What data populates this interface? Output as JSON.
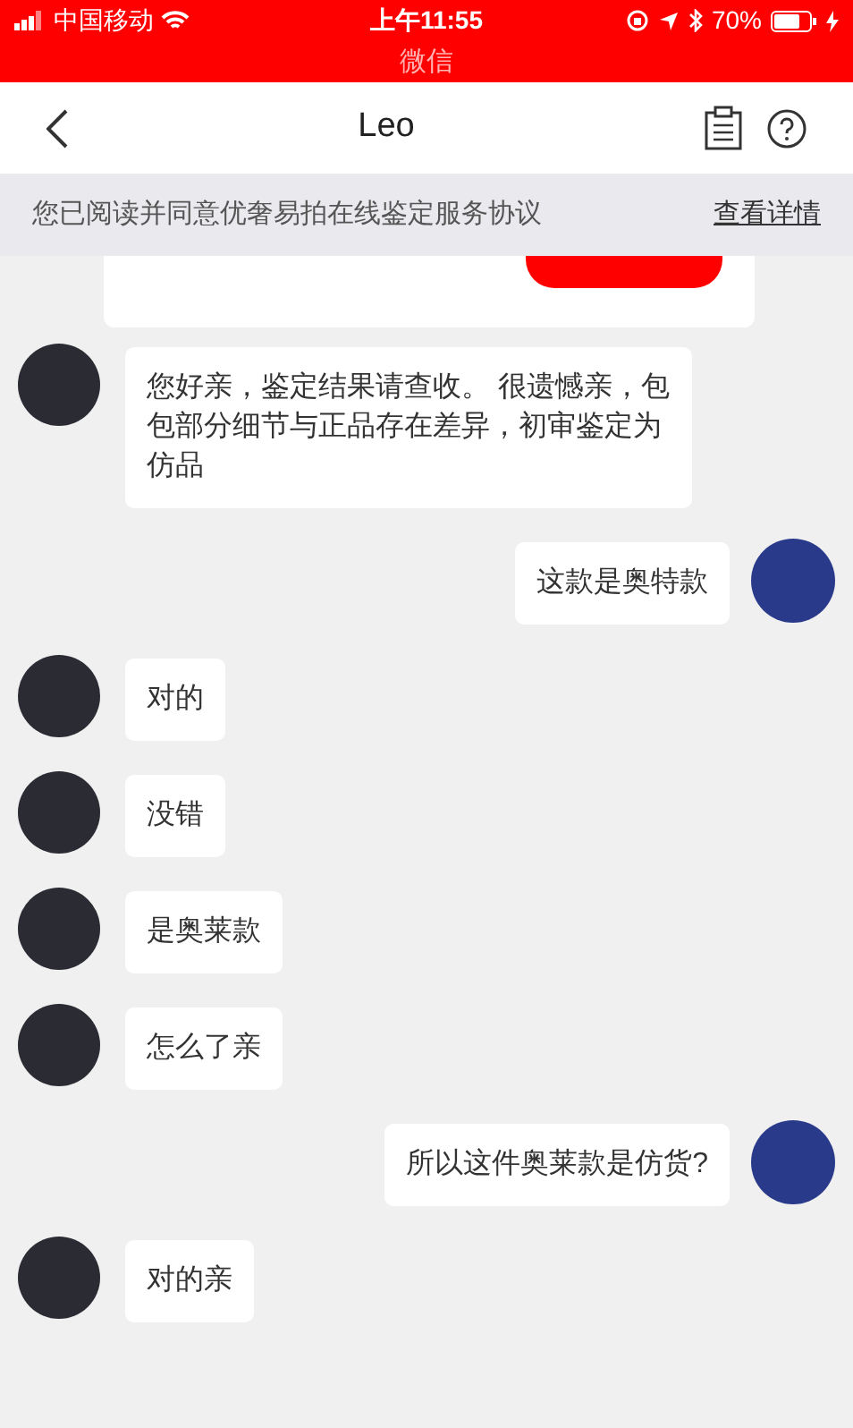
{
  "status_bar": {
    "carrier": "中国移动",
    "time": "上午11:55",
    "battery": "70%",
    "back_app": "微信"
  },
  "header": {
    "title": "Leo"
  },
  "notice": {
    "text": "您已阅读并同意优奢易拍在线鉴定服务协议",
    "link": "查看详情"
  },
  "messages": [
    {
      "kind": "received",
      "text": "您好亲，鉴定结果请查收。 很遗憾亲，包包部分细节与正品存在差异，初审鉴定为仿品"
    },
    {
      "kind": "sent",
      "text": "这款是奥特款"
    },
    {
      "kind": "received",
      "text": "对的"
    },
    {
      "kind": "received",
      "text": "没错"
    },
    {
      "kind": "received",
      "text": "是奥莱款"
    },
    {
      "kind": "received",
      "text": "怎么了亲"
    },
    {
      "kind": "sent",
      "text": "所以这件奥莱款是仿货?"
    },
    {
      "kind": "received",
      "text": "对的亲"
    }
  ]
}
